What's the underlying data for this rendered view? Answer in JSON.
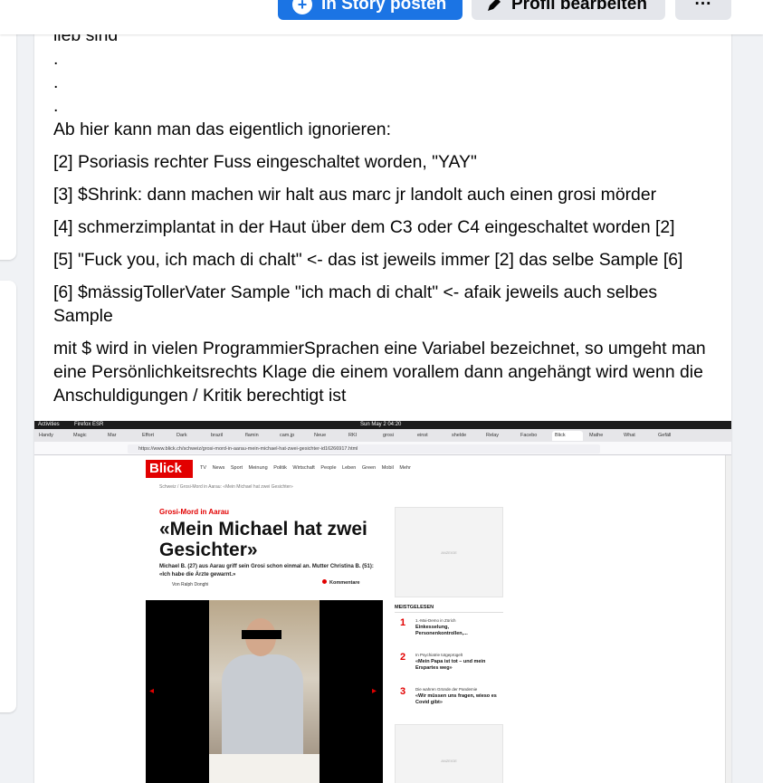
{
  "header": {
    "story_button": "In Story posten",
    "edit_button": "Profil bearbeiten",
    "more_button": "···"
  },
  "post": {
    "lines": [
      "lieb sind",
      ".",
      ".",
      ".",
      "Ab hier kann man das eigentlich ignorieren:",
      "[2] Psoriasis rechter Fuss eingeschaltet worden, \"YAY\"",
      "[3] $Shrink: dann machen wir halt aus marc jr landolt auch einen grosi mörder",
      "[4] schmerzimplantat in der Haut über dem C3 oder C4 eingeschaltet worden [2]",
      "[5] \"Fuck you, ich mach di chalt\" <- das ist jeweils immer [2] das selbe Sample [6]",
      "[6] $mässigTollerVater Sample \"ich mach di chalt\" <- afaik jeweils auch selbes Sample",
      "mit $ wird in vielen ProgrammierSprachen eine Variabel bezeichnet, so umgeht man eine Persönlichkeitsrechts Klage die einem vorallem dann angehängt wird wenn die Anschuldigungen / Kritik berechtigt ist"
    ]
  },
  "screenshot": {
    "os_bar": {
      "activities": "Activities",
      "browser": "Firefox ESR",
      "clock": "Sun May 2  04:20"
    },
    "tabs": [
      "Handy",
      "Magic",
      "Mar",
      "Effort",
      "Dark",
      "brazil",
      "flamin",
      "cam.jp",
      "Neue",
      "RKI",
      "grosi",
      "einst",
      "shelde",
      "Relay",
      "Facebo",
      "Blick",
      "Mathe",
      "What",
      "Gefäll"
    ],
    "url": "https://www.blick.ch/schweiz/grosi-mord-in-aarau-mein-michael-hat-zwei-gesichter-id16266917.html",
    "site": {
      "logo": "Blick",
      "nav": [
        "TV",
        "News",
        "Sport",
        "Meinung",
        "Politik",
        "Wirtschaft",
        "People",
        "Leben",
        "Green",
        "Mobil",
        "Mehr"
      ],
      "breadcrumb": "Schweiz / Grosi-Mord in Aarau: «Mein Michael hat zwei Gesichter»",
      "kicker": "Grosi-Mord in Aarau",
      "headline": "«Mein Michael hat zwei Gesichter»",
      "lead": "Michael B. (27) aus Aarau griff sein Grosi schon einmal an. Mutter Christina B. (51): «Ich habe die Ärzte gewarnt.»",
      "author": "Von Ralph Donghi",
      "comments": "Kommentare",
      "ad_label": "ANZEIGE",
      "most_read_title": "MEISTGELESEN",
      "most_read": [
        {
          "num": "1",
          "kicker": "1.-Mai-Demo in Zürich",
          "title": "Einkesselung, Personenkontrollen,..."
        },
        {
          "num": "2",
          "kicker": "In Psychiatrie totgeprügelt",
          "title": "«Mein Papa ist tot – und mein Erspartes weg»"
        },
        {
          "num": "3",
          "kicker": "Die wahren Gründe der Pandemie",
          "title": "«Wir müssen uns fragen, wieso es Covid gibt»"
        }
      ]
    }
  }
}
